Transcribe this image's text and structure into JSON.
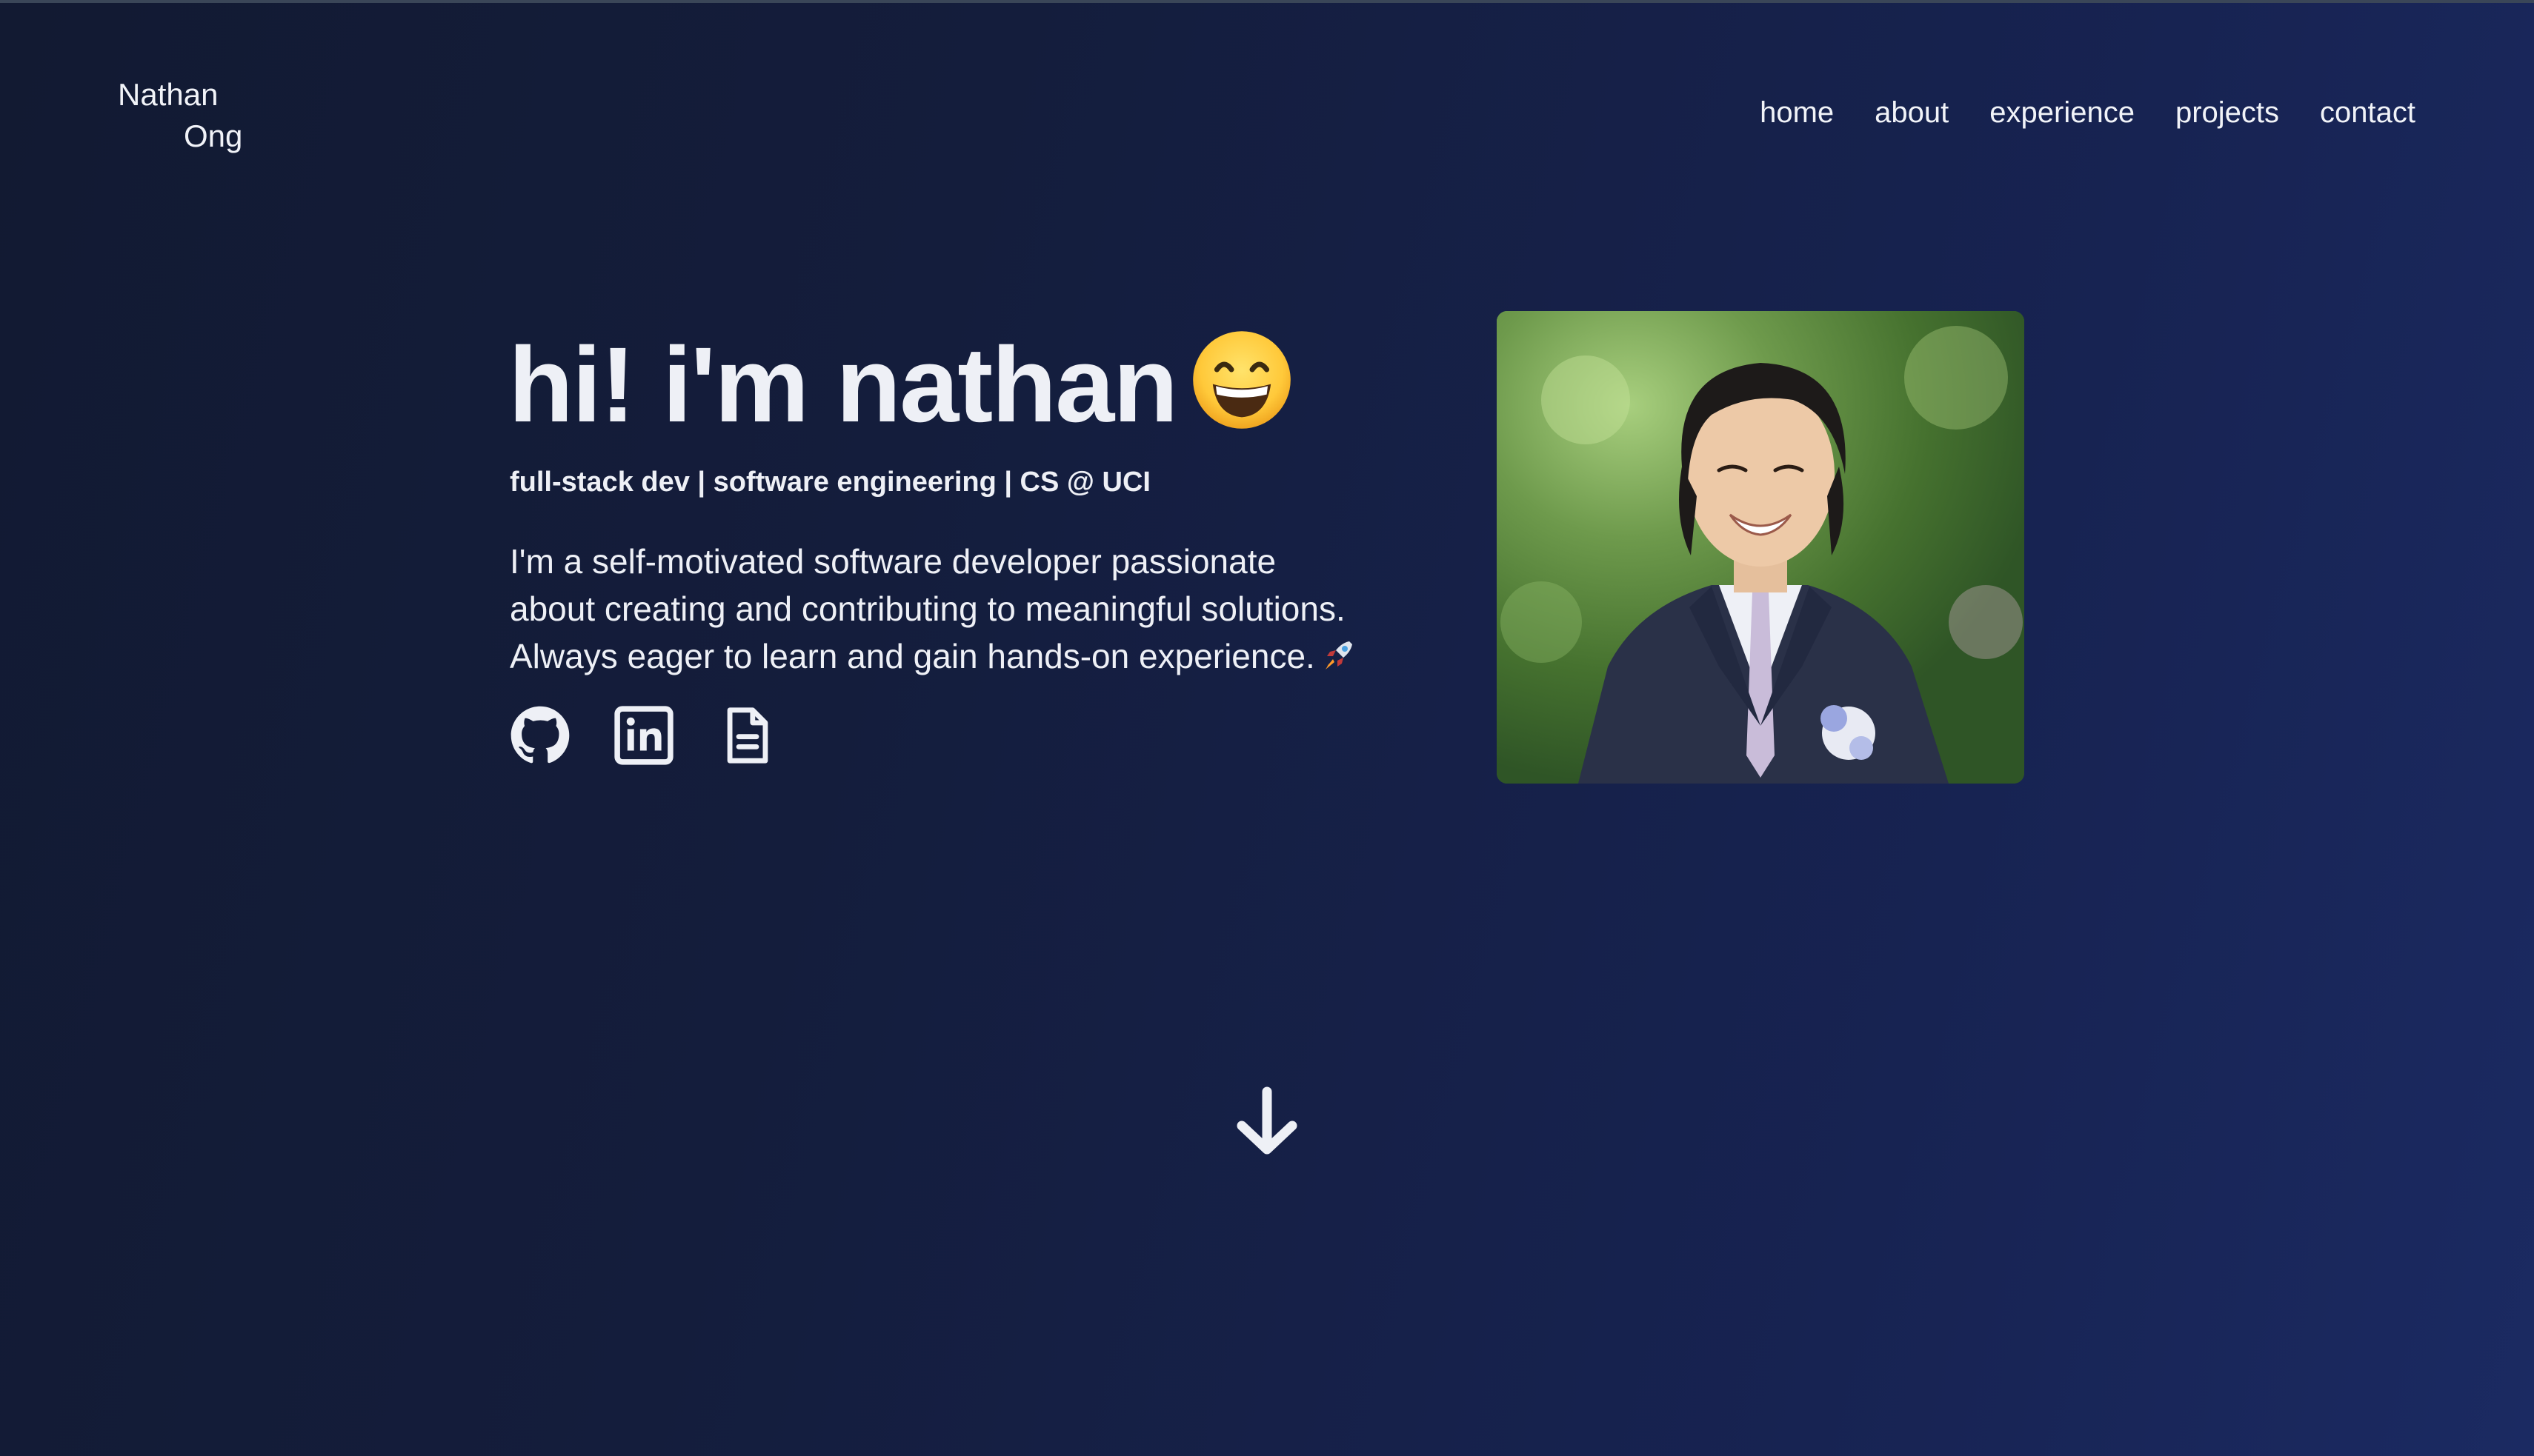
{
  "logo": {
    "first": "Nathan",
    "last": "Ong"
  },
  "nav": {
    "items": [
      {
        "label": "home"
      },
      {
        "label": "about"
      },
      {
        "label": "experience"
      },
      {
        "label": "projects"
      },
      {
        "label": "contact"
      }
    ]
  },
  "hero": {
    "title": "hi! i'm nathan",
    "subtitle": "full-stack dev | software engineering | CS @ UCI",
    "bio_lines": [
      "I'm a self-motivated software developer passionate",
      "about creating and contributing to meaningful solutions.",
      "Always eager to learn and gain hands-on experience."
    ]
  },
  "socials": {
    "icons": [
      "github-icon",
      "linkedin-icon",
      "resume-document-icon"
    ]
  },
  "colors": {
    "bg_dark": "#121a32",
    "bg_light": "#1b2a62",
    "text": "#eef0f6"
  }
}
